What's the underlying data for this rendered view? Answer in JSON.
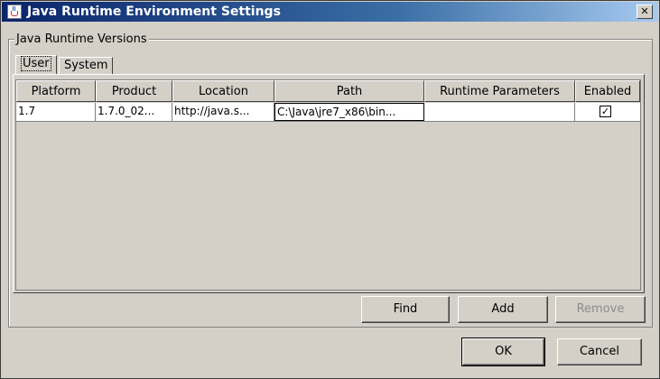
{
  "window": {
    "title": "Java Runtime Environment Settings",
    "close_glyph": "✕"
  },
  "group": {
    "legend": "Java Runtime Versions"
  },
  "tabs": [
    {
      "label": "User",
      "selected": true
    },
    {
      "label": "System",
      "selected": false
    }
  ],
  "table": {
    "headers": [
      "Platform",
      "Product",
      "Location",
      "Path",
      "Runtime Parameters",
      "Enabled"
    ],
    "rows": [
      {
        "platform": "1.7",
        "product": "1.7.0_02...",
        "location": "http://java.s...",
        "path": "C:\\Java\\jre7_x86\\bin...",
        "runtime_parameters": "",
        "enabled": true,
        "enabled_glyph": "✓"
      }
    ]
  },
  "panel_buttons": {
    "find": "Find",
    "add": "Add",
    "remove": "Remove"
  },
  "dialog_buttons": {
    "ok": "OK",
    "cancel": "Cancel"
  }
}
